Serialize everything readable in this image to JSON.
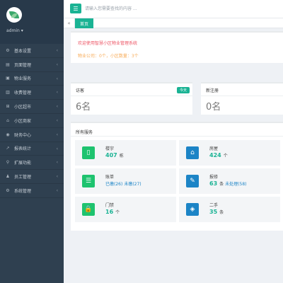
{
  "user": {
    "name": "admin ▾"
  },
  "search": {
    "placeholder": "请输入您需要查找的内容 ..."
  },
  "tabs": {
    "back": "«",
    "home": "首页"
  },
  "sidebar": {
    "items": [
      {
        "label": "基本设置",
        "icon": "⚙",
        "icon_name": "gear-icon"
      },
      {
        "label": "页面管理",
        "icon": "▤",
        "icon_name": "page-icon"
      },
      {
        "label": "物业服务",
        "icon": "▣",
        "icon_name": "service-icon"
      },
      {
        "label": "收费管理",
        "icon": "▥",
        "icon_name": "fee-icon"
      },
      {
        "label": "小区超市",
        "icon": "⊞",
        "icon_name": "market-icon"
      },
      {
        "label": "小区商家",
        "icon": "⌂",
        "icon_name": "shop-icon"
      },
      {
        "label": "财务中心",
        "icon": "◉",
        "icon_name": "finance-icon"
      },
      {
        "label": "报表统计",
        "icon": "↗",
        "icon_name": "chart-icon"
      },
      {
        "label": "扩展功能",
        "icon": "⚲",
        "icon_name": "extend-icon"
      },
      {
        "label": "员工管理",
        "icon": "♟",
        "icon_name": "staff-icon"
      },
      {
        "label": "系统管理",
        "icon": "⚙",
        "icon_name": "system-icon"
      }
    ],
    "arrow": "‹"
  },
  "welcome": {
    "title": "欢迎使用智慧小区物业管理系统",
    "subtitle": "物业公司：0个，小区数量：3个"
  },
  "stats": {
    "visitors": {
      "label": "访客",
      "badge": "今天",
      "value": "6名"
    },
    "registrations": {
      "label": "新注册",
      "value": "0名"
    }
  },
  "services": {
    "title": "所有服务",
    "items": [
      {
        "name": "楼宇",
        "icon": "▯",
        "icon_name": "building-icon",
        "color": "green",
        "value": "407",
        "unit": "栋"
      },
      {
        "name": "房屋",
        "icon": "⌂",
        "icon_name": "house-icon",
        "color": "blue",
        "value": "424",
        "unit": "个"
      },
      {
        "name": "账单",
        "icon": "☰",
        "icon_name": "bill-list-icon",
        "color": "green",
        "paid": "已缴(26)",
        "unpaid": "未缴(27)"
      },
      {
        "name": "报修",
        "icon": "✎",
        "icon_name": "wrench-icon",
        "color": "blue",
        "value": "63",
        "unit": "条",
        "extra": "未处理(58)"
      },
      {
        "name": "门禁",
        "icon": "🔒",
        "icon_name": "lock-icon",
        "color": "green",
        "value": "16",
        "unit": "个"
      },
      {
        "name": "二手",
        "icon": "◈",
        "icon_name": "box-icon",
        "color": "blue",
        "value": "35",
        "unit": "条"
      }
    ]
  },
  "colors": {
    "accent": "#1ab394",
    "sidebar": "#2f4050",
    "link": "#1c84c6",
    "alert": "#ed5565",
    "warning": "#f8ac59"
  }
}
